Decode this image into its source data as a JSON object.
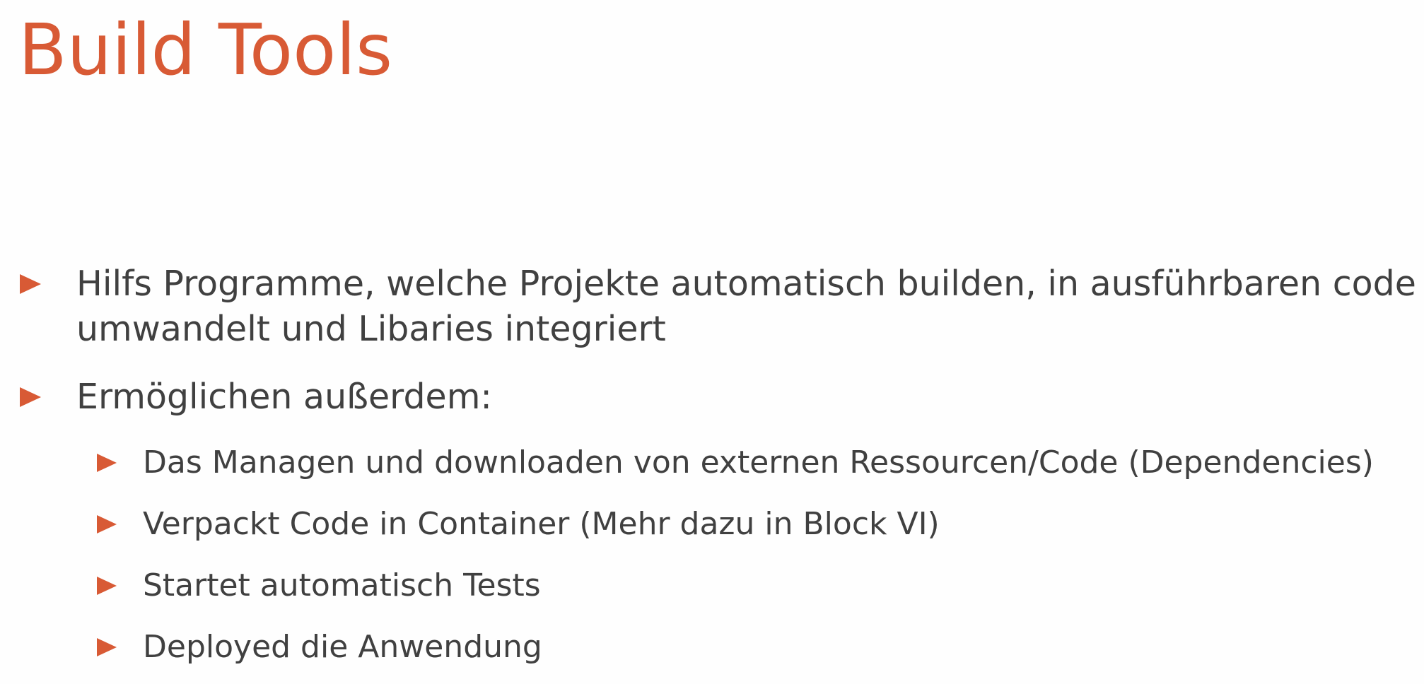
{
  "slide": {
    "title": "Build Tools",
    "accent_color": "#d85a35",
    "text_color": "#404040",
    "bullets": [
      {
        "lines": [
          "Hilfs Programme, welche Projekte automatisch builden, in ausführbaren code",
          "umwandelt und Libaries integriert"
        ]
      },
      {
        "lines": [
          "Ermöglichen außerdem:"
        ],
        "sub": [
          "Das Managen und downloaden von externen Ressourcen/Code (Dependencies)",
          "Verpackt Code in Container (Mehr dazu in Block VI)",
          "Startet automatisch Tests",
          "Deployed die Anwendung"
        ]
      }
    ]
  }
}
